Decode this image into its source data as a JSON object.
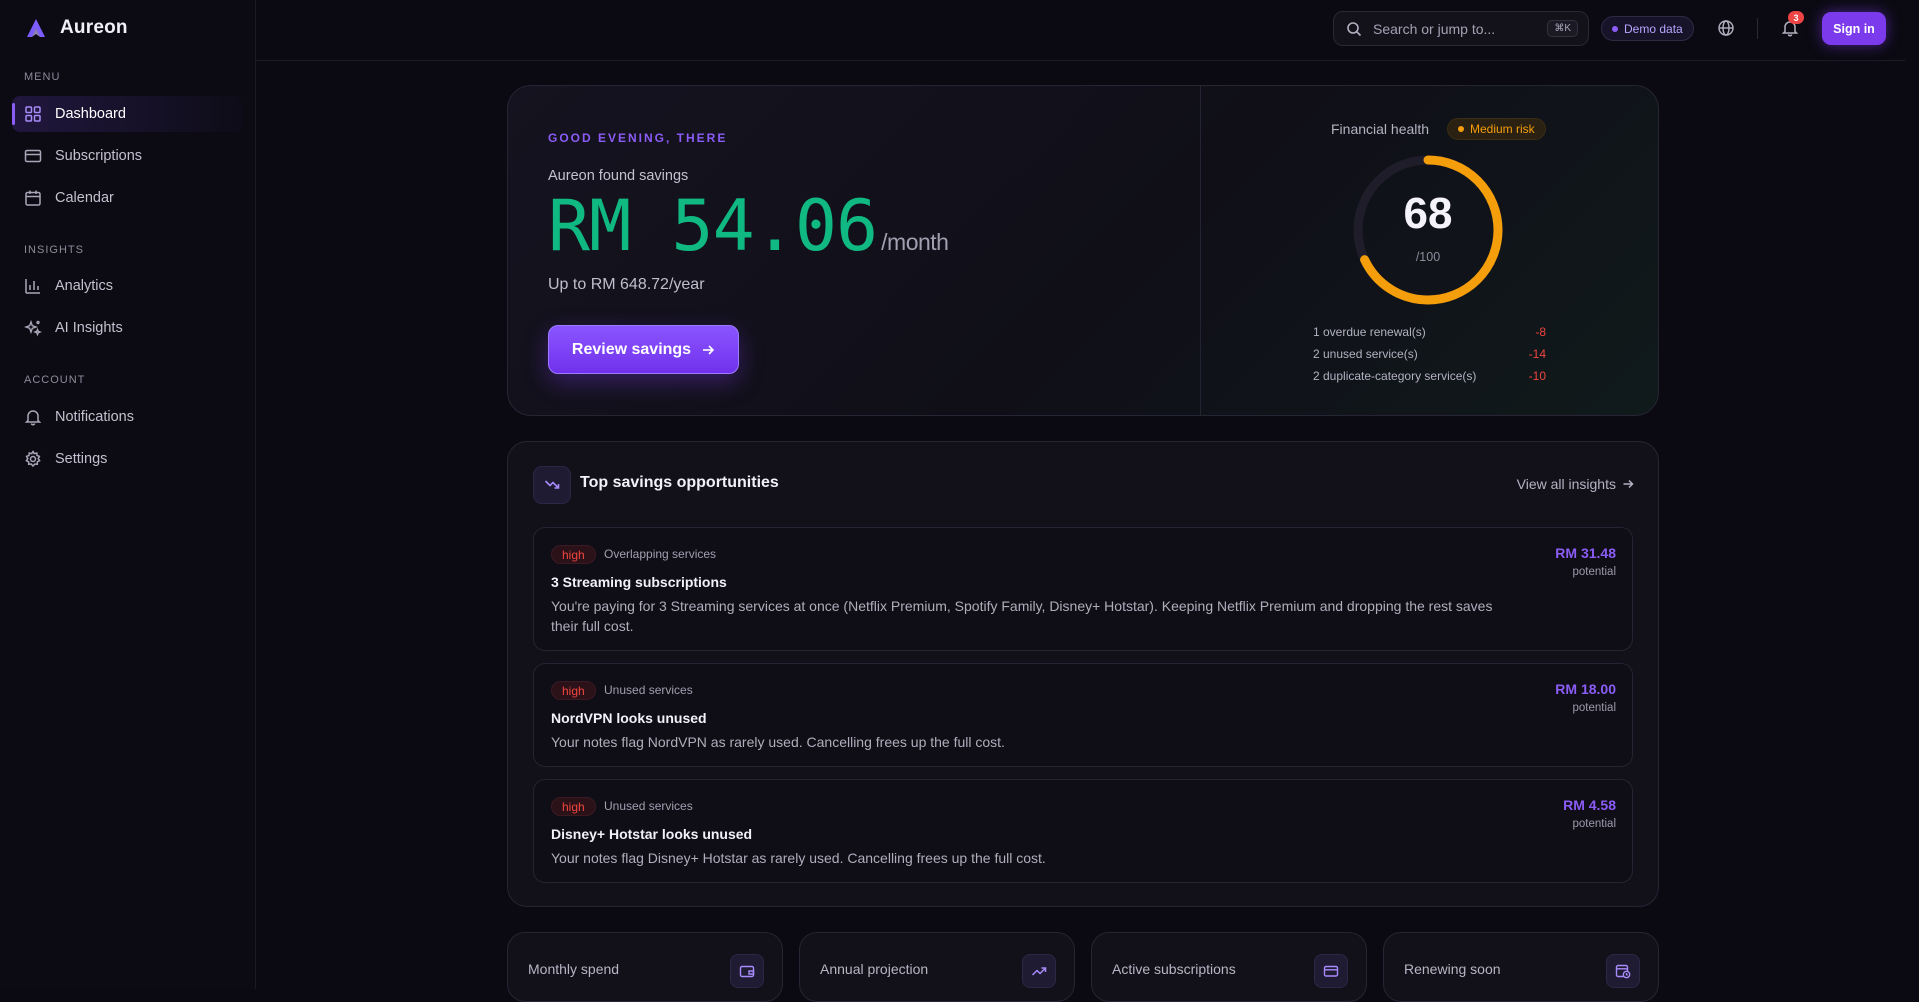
{
  "app": {
    "name": "Aureon"
  },
  "sidebar": {
    "sections": [
      {
        "label": "MENU",
        "items": [
          {
            "label": "Dashboard",
            "icon": "grid-icon",
            "active": true
          },
          {
            "label": "Subscriptions",
            "icon": "card-icon"
          },
          {
            "label": "Calendar",
            "icon": "calendar-icon"
          }
        ]
      },
      {
        "label": "INSIGHTS",
        "items": [
          {
            "label": "Analytics",
            "icon": "bar-chart-icon"
          },
          {
            "label": "AI Insights",
            "icon": "sparkles-icon"
          }
        ]
      },
      {
        "label": "ACCOUNT",
        "items": [
          {
            "label": "Notifications",
            "icon": "bell-icon"
          },
          {
            "label": "Settings",
            "icon": "gear-icon"
          }
        ]
      }
    ]
  },
  "topbar": {
    "search_placeholder": "Search or jump to...",
    "shortcut": "⌘K",
    "demo_label": "Demo data",
    "notification_count": "3",
    "sign_in": "Sign in"
  },
  "hero": {
    "greeting": "GOOD EVENING, THERE",
    "found_label": "Aureon found savings",
    "amount": "RM 54.06",
    "per": "/month",
    "yearly": "Up to RM 648.72/year",
    "cta": "Review savings",
    "health_label": "Financial health",
    "risk_label": "Medium risk",
    "score": "68",
    "score_max": "/100",
    "score_fraction": 0.68,
    "factors": [
      {
        "label": "1 overdue renewal(s)",
        "value": "-8"
      },
      {
        "label": "2 unused service(s)",
        "value": "-14"
      },
      {
        "label": "2 duplicate-category service(s)",
        "value": "-10"
      }
    ]
  },
  "opportunities": {
    "title": "Top savings opportunities",
    "view_all": "View all insights",
    "items": [
      {
        "severity": "high",
        "category": "Overlapping services",
        "title": "3 Streaming subscriptions",
        "description": "You're paying for 3 Streaming services at once (Netflix Premium, Spotify Family, Disney+ Hotstar). Keeping Netflix Premium and dropping the rest saves their full cost.",
        "amount": "RM 31.48",
        "amount_label": "potential"
      },
      {
        "severity": "high",
        "category": "Unused services",
        "title": "NordVPN looks unused",
        "description": "Your notes flag NordVPN as rarely used. Cancelling frees up the full cost.",
        "amount": "RM 18.00",
        "amount_label": "potential"
      },
      {
        "severity": "high",
        "category": "Unused services",
        "title": "Disney+ Hotstar looks unused",
        "description": "Your notes flag Disney+ Hotstar as rarely used. Cancelling frees up the full cost.",
        "amount": "RM 4.58",
        "amount_label": "potential"
      }
    ]
  },
  "stats": [
    {
      "label": "Monthly spend",
      "icon": "wallet-icon"
    },
    {
      "label": "Annual projection",
      "icon": "trend-up-icon"
    },
    {
      "label": "Active subscriptions",
      "icon": "card-icon"
    },
    {
      "label": "Renewing soon",
      "icon": "calendar-clock-icon"
    }
  ],
  "colors": {
    "accent": "#8b5cf6",
    "savings": "#10b981",
    "risk": "#f59e0b",
    "negative": "#f0453f"
  }
}
